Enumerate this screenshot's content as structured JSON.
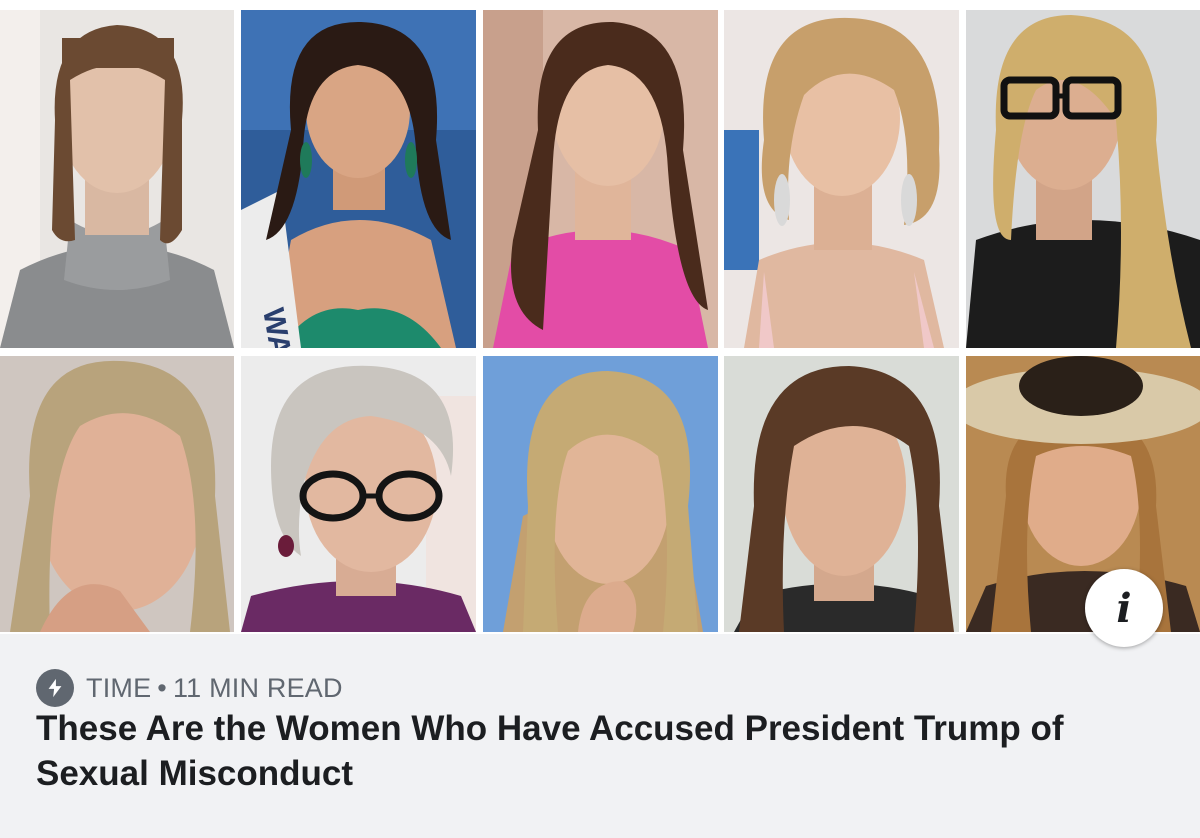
{
  "card": {
    "source": "TIME",
    "separator": "•",
    "read_time": "11 MIN READ",
    "headline": "These Are the Women Who Have Accused President Trump of Sexual Misconduct",
    "info_label": "i",
    "icons": {
      "source_badge": "lightning-bolt-icon",
      "info": "info-icon"
    }
  },
  "photos": [
    {
      "id": "photo-1",
      "sash_text": ""
    },
    {
      "id": "photo-2",
      "sash_text": "WASHI"
    },
    {
      "id": "photo-3",
      "sash_text": ""
    },
    {
      "id": "photo-4",
      "sash_text": ""
    },
    {
      "id": "photo-5",
      "sash_text": ""
    },
    {
      "id": "photo-6",
      "sash_text": ""
    },
    {
      "id": "photo-7",
      "sash_text": ""
    },
    {
      "id": "photo-8",
      "sash_text": ""
    },
    {
      "id": "photo-9",
      "sash_text": ""
    },
    {
      "id": "photo-10",
      "sash_text": ""
    }
  ],
  "colors": {
    "card_background": "#f1f2f4",
    "meta_text": "#606770",
    "headline_text": "#1c1e21"
  }
}
